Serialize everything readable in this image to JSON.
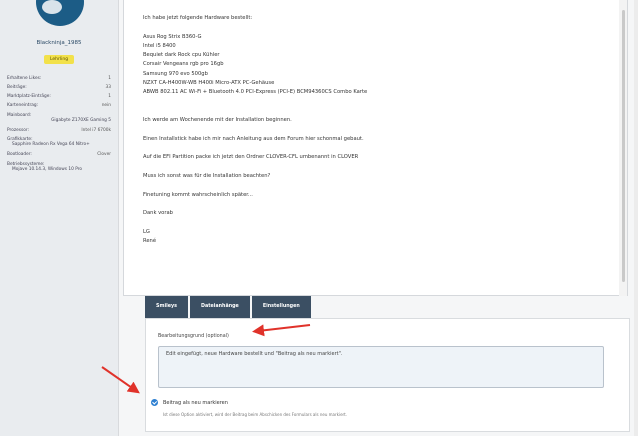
{
  "sidebar": {
    "username": "Blackninja_1985",
    "rank": "Lehrling",
    "stats": [
      {
        "label": "Erhaltene Likes:",
        "value": "1"
      },
      {
        "label": "Beiträge:",
        "value": "33"
      },
      {
        "label": "Marktplatz-Einträge:",
        "value": "1"
      },
      {
        "label": "Karteneintrag:",
        "value": "nein"
      }
    ],
    "blocks": [
      {
        "label": "Mainboard:",
        "value": "Gigabyte Z170XE Gaming 5",
        "align": "right"
      },
      {
        "label": "Prozessor:",
        "value": "Intel i7 6700k",
        "inline": true
      },
      {
        "label": "Grafikkarte:",
        "value": "Sapphire Radeon Rx Vega 64 Nitro+",
        "align": "left"
      },
      {
        "label": "Bootloader:",
        "value": "Clover",
        "inline": true
      },
      {
        "label": "Betriebssysteme:",
        "value": "Mojave 10.14.3, Windows 10 Pro",
        "align": "left"
      }
    ]
  },
  "editor": {
    "lines": [
      "Ich habe jetzt folgende Hardware bestellt:",
      "",
      "Asus Rog Strix B360-G",
      "Intel i5 8400",
      "Bequiet dark Rock cpu Kühler",
      "Corsair Vengeans rgb pro 16gb",
      "Samsung 970 evo 500gb",
      "NZXT CA-H400W-WB H400i Micro-ATX PC-Gehäuse",
      "ABWB 802.11 AC Wi-Fi + Bluetooth 4.0 PCI-Express (PCI-E) BCM94360CS Combo Karte",
      "",
      "",
      "Ich werde am Wochenende mit der Installation beginnen.",
      "",
      "Einen Installstick habe ich mir nach Anleitung aus dem Forum hier schonmal gebaut.",
      "",
      "Auf die EFI Partition packe ich jetzt den Ordner CLOVER-CFL umbenannt in CLOVER",
      "",
      "Muss ich sonst was für die Installation beachten?",
      "",
      "Finetuning kommt wahrscheinlich später...",
      "",
      "Dank vorab",
      "",
      "LG",
      "René"
    ]
  },
  "tabs": [
    "Smileys",
    "Dateianhänge",
    "Einstellungen"
  ],
  "form": {
    "reason_label": "Bearbeitungsgrund (optional)",
    "reason_value": "Edit eingefügt, neue Hardware bestellt und \"Beitrag als neu markiert\".",
    "checkbox_label": "Beitrag als neu markieren",
    "checkbox_hint": "Ist diese Option aktiviert, wird der Beitrag beim Abschicken des Formulars als neu markiert.",
    "checkbox_checked": true
  },
  "colors": {
    "tab_bg": "#3b4f63",
    "accent": "#2d7fd1",
    "annotation_arrow": "#e0322a",
    "rank_badge": "#f2e14a"
  }
}
